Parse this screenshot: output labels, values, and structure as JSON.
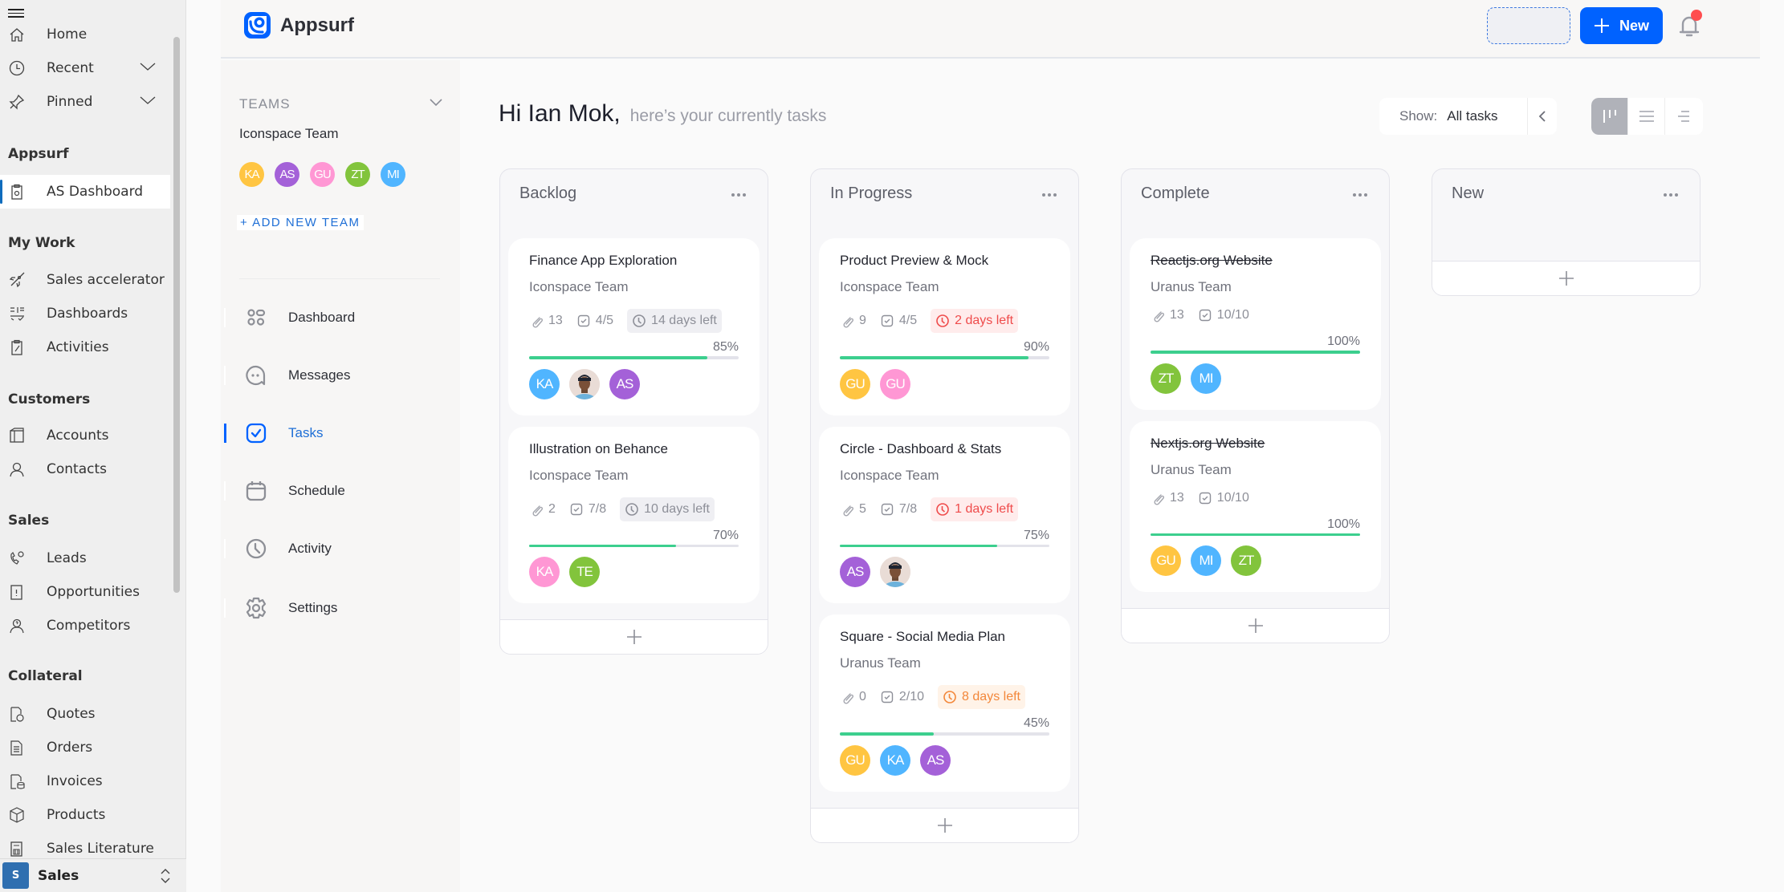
{
  "appnav": {
    "items": [
      {
        "label": "Home",
        "icon": "home-icon"
      },
      {
        "label": "Recent",
        "icon": "clock-icon",
        "expandable": true
      },
      {
        "label": "Pinned",
        "icon": "pin-icon",
        "expandable": true
      }
    ],
    "groups": [
      {
        "title": "Appsurf",
        "items": [
          {
            "label": "AS Dashboard",
            "icon": "dashboard-clipboard-icon",
            "active": true
          }
        ]
      },
      {
        "title": "My Work",
        "items": [
          {
            "label": "Sales accelerator",
            "icon": "rocket-icon"
          },
          {
            "label": "Dashboards",
            "icon": "dashboards-icon"
          },
          {
            "label": "Activities",
            "icon": "activities-icon"
          }
        ]
      },
      {
        "title": "Customers",
        "items": [
          {
            "label": "Accounts",
            "icon": "accounts-icon"
          },
          {
            "label": "Contacts",
            "icon": "contact-icon"
          }
        ]
      },
      {
        "title": "Sales",
        "items": [
          {
            "label": "Leads",
            "icon": "leads-icon"
          },
          {
            "label": "Opportunities",
            "icon": "opportunities-icon"
          },
          {
            "label": "Competitors",
            "icon": "competitors-icon"
          }
        ]
      },
      {
        "title": "Collateral",
        "items": [
          {
            "label": "Quotes",
            "icon": "quotes-icon"
          },
          {
            "label": "Orders",
            "icon": "orders-icon"
          },
          {
            "label": "Invoices",
            "icon": "invoices-icon"
          },
          {
            "label": "Products",
            "icon": "products-icon"
          },
          {
            "label": "Sales Literature",
            "icon": "sales-literature-icon"
          }
        ]
      }
    ],
    "area": {
      "badge": "S",
      "label": "Sales"
    }
  },
  "header": {
    "brand": "Appsurf",
    "new_label": "New",
    "brand_color": "#0062ff"
  },
  "teams": {
    "label": "TEAMS",
    "team_name": "Iconspace Team",
    "members": [
      {
        "initials": "KA",
        "color": "#ffc542"
      },
      {
        "initials": "AS",
        "color": "#a461d8"
      },
      {
        "initials": "GU",
        "color": "#ff97d4"
      },
      {
        "initials": "ZT",
        "color": "#82c43c"
      },
      {
        "initials": "MI",
        "color": "#50b5ff"
      }
    ],
    "add_team": "+ ADD NEW TEAM",
    "menu": [
      {
        "label": "Dashboard",
        "icon": "dashboard-icon"
      },
      {
        "label": "Messages",
        "icon": "messages-icon"
      },
      {
        "label": "Tasks",
        "icon": "tasks-icon",
        "active": true
      },
      {
        "label": "Schedule",
        "icon": "calendar-icon"
      },
      {
        "label": "Activity",
        "icon": "activity-clock-icon"
      },
      {
        "label": "Settings",
        "icon": "settings-icon"
      }
    ]
  },
  "main": {
    "greeting": "Hi Ian Mok,",
    "subtitle": "here’s your currently tasks",
    "show_label": "Show:",
    "show_value": "All tasks",
    "columns": [
      {
        "title": "Backlog",
        "cards": [
          {
            "title": "Finance App Exploration",
            "team": "Iconspace Team",
            "attachments": "13",
            "checklist": "4/5",
            "due": "14 days left",
            "due_style": "gray",
            "progress": 85,
            "done": false,
            "members": [
              {
                "initials": "KA",
                "color": "#50b5ff"
              },
              {
                "initials": "",
                "photo": true
              },
              {
                "initials": "AS",
                "color": "#a461d8"
              }
            ]
          },
          {
            "title": "Illustration on Behance",
            "team": "Iconspace Team",
            "attachments": "2",
            "checklist": "7/8",
            "due": "10 days left",
            "due_style": "gray",
            "progress": 70,
            "done": false,
            "members": [
              {
                "initials": "KA",
                "color": "#ff97d4"
              },
              {
                "initials": "TE",
                "color": "#82c43c"
              }
            ]
          }
        ]
      },
      {
        "title": "In Progress",
        "cards": [
          {
            "title": "Product Preview & Mock",
            "team": "Iconspace Team",
            "attachments": "9",
            "checklist": "4/5",
            "due": "2 days left",
            "due_style": "red",
            "progress": 90,
            "done": false,
            "members": [
              {
                "initials": "GU",
                "color": "#ffc542"
              },
              {
                "initials": "GU",
                "color": "#ff97d4"
              }
            ]
          },
          {
            "title": "Circle - Dashboard & Stats",
            "team": "Iconspace Team",
            "attachments": "5",
            "checklist": "7/8",
            "due": "1 days left",
            "due_style": "red",
            "progress": 75,
            "done": false,
            "members": [
              {
                "initials": "AS",
                "color": "#a461d8"
              },
              {
                "initials": "",
                "photo": true
              }
            ]
          },
          {
            "title": "Square - Social Media Plan",
            "team": "Uranus Team",
            "attachments": "0",
            "checklist": "2/10",
            "due": "8 days left",
            "due_style": "orange",
            "progress": 45,
            "done": false,
            "members": [
              {
                "initials": "GU",
                "color": "#ffc542"
              },
              {
                "initials": "KA",
                "color": "#50b5ff"
              },
              {
                "initials": "AS",
                "color": "#a461d8"
              }
            ]
          }
        ]
      },
      {
        "title": "Complete",
        "cards": [
          {
            "title": "Reactjs.org Website",
            "team": "Uranus Team",
            "attachments": "13",
            "checklist": "10/10",
            "due": "",
            "due_style": "",
            "progress": 100,
            "done": true,
            "members": [
              {
                "initials": "ZT",
                "color": "#82c43c"
              },
              {
                "initials": "MI",
                "color": "#50b5ff"
              }
            ]
          },
          {
            "title": "Nextjs.org Website",
            "team": "Uranus Team",
            "attachments": "13",
            "checklist": "10/10",
            "due": "",
            "due_style": "",
            "progress": 100,
            "done": true,
            "members": [
              {
                "initials": "GU",
                "color": "#ffc542"
              },
              {
                "initials": "MI",
                "color": "#50b5ff"
              },
              {
                "initials": "ZT",
                "color": "#82c43c"
              }
            ]
          }
        ]
      },
      {
        "title": "New",
        "cards": []
      }
    ]
  }
}
